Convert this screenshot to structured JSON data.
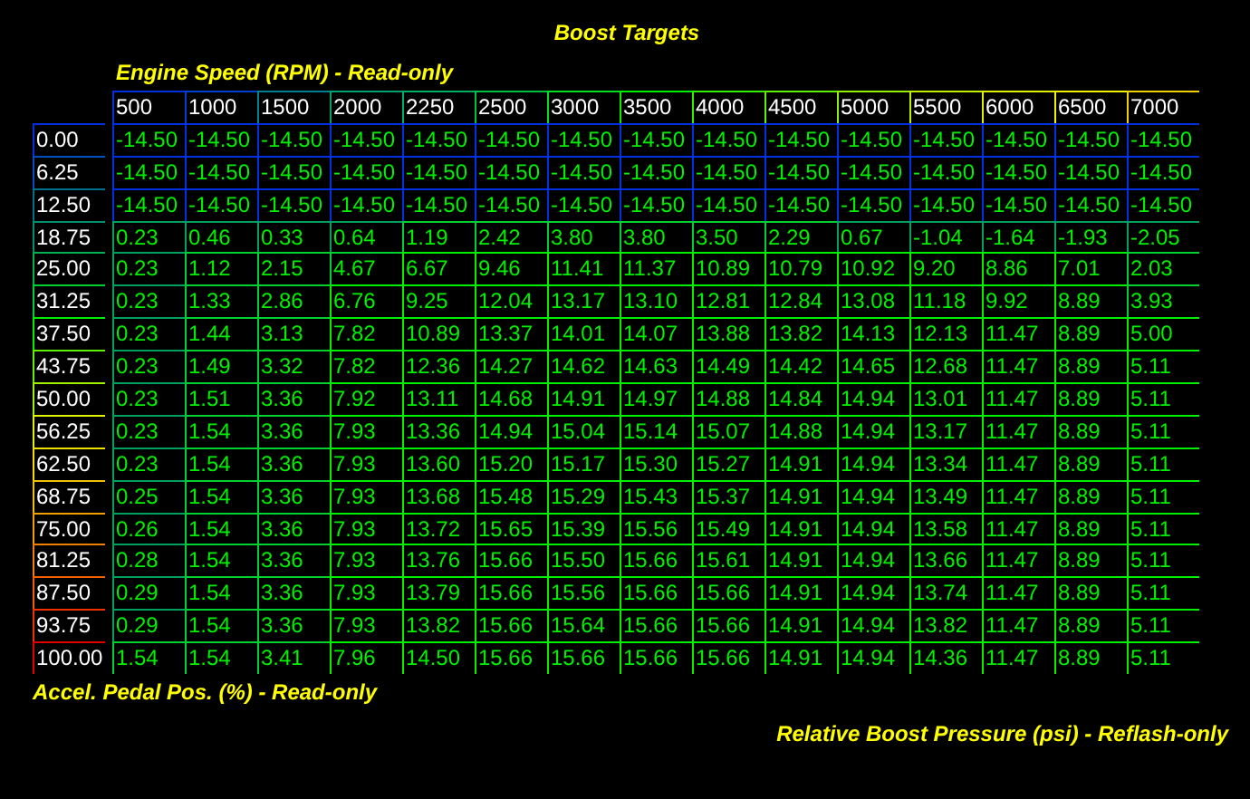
{
  "title": "Boost Targets",
  "x_axis": {
    "label": "Engine Speed (RPM) - Read-only",
    "columns": [
      {
        "text": "500",
        "color": "#0030e0"
      },
      {
        "text": "1000",
        "color": "#0040d0"
      },
      {
        "text": "1500",
        "color": "#008090"
      },
      {
        "text": "2000",
        "color": "#00a070"
      },
      {
        "text": "2250",
        "color": "#00b060"
      },
      {
        "text": "2500",
        "color": "#00c040"
      },
      {
        "text": "3000",
        "color": "#00e020"
      },
      {
        "text": "3500",
        "color": "#00f000"
      },
      {
        "text": "4000",
        "color": "#30f000"
      },
      {
        "text": "4500",
        "color": "#60f000"
      },
      {
        "text": "5000",
        "color": "#90f000"
      },
      {
        "text": "5500",
        "color": "#c0f000"
      },
      {
        "text": "6000",
        "color": "#e0f000"
      },
      {
        "text": "6500",
        "color": "#f0f000"
      },
      {
        "text": "7000",
        "color": "#f0d000"
      }
    ]
  },
  "y_axis": {
    "label": "Accel. Pedal Pos. (%) - Read-only",
    "rows": [
      {
        "text": "0.00",
        "color": "#0030e0"
      },
      {
        "text": "6.25",
        "color": "#0050c0"
      },
      {
        "text": "12.50",
        "color": "#007090"
      },
      {
        "text": "18.75",
        "color": "#009070"
      },
      {
        "text": "25.00",
        "color": "#00b050"
      },
      {
        "text": "31.25",
        "color": "#00d030"
      },
      {
        "text": "37.50",
        "color": "#00f000"
      },
      {
        "text": "43.75",
        "color": "#60f000"
      },
      {
        "text": "50.00",
        "color": "#a0f000"
      },
      {
        "text": "56.25",
        "color": "#e0f000"
      },
      {
        "text": "62.50",
        "color": "#f0e000"
      },
      {
        "text": "68.75",
        "color": "#f0c000"
      },
      {
        "text": "75.00",
        "color": "#f0a000"
      },
      {
        "text": "81.25",
        "color": "#f08000"
      },
      {
        "text": "87.50",
        "color": "#f06000"
      },
      {
        "text": "93.75",
        "color": "#f03000"
      },
      {
        "text": "100.00",
        "color": "#e00000"
      }
    ]
  },
  "values_label": "Relative Boost Pressure (psi) - Reflash-only",
  "cells": [
    [
      "-14.50",
      "-14.50",
      "-14.50",
      "-14.50",
      "-14.50",
      "-14.50",
      "-14.50",
      "-14.50",
      "-14.50",
      "-14.50",
      "-14.50",
      "-14.50",
      "-14.50",
      "-14.50",
      "-14.50"
    ],
    [
      "-14.50",
      "-14.50",
      "-14.50",
      "-14.50",
      "-14.50",
      "-14.50",
      "-14.50",
      "-14.50",
      "-14.50",
      "-14.50",
      "-14.50",
      "-14.50",
      "-14.50",
      "-14.50",
      "-14.50"
    ],
    [
      "-14.50",
      "-14.50",
      "-14.50",
      "-14.50",
      "-14.50",
      "-14.50",
      "-14.50",
      "-14.50",
      "-14.50",
      "-14.50",
      "-14.50",
      "-14.50",
      "-14.50",
      "-14.50",
      "-14.50"
    ],
    [
      "0.23",
      "0.46",
      "0.33",
      "0.64",
      "1.19",
      "2.42",
      "3.80",
      "3.80",
      "3.50",
      "2.29",
      "0.67",
      "-1.04",
      "-1.64",
      "-1.93",
      "-2.05"
    ],
    [
      "0.23",
      "1.12",
      "2.15",
      "4.67",
      "6.67",
      "9.46",
      "11.41",
      "11.37",
      "10.89",
      "10.79",
      "10.92",
      "9.20",
      "8.86",
      "7.01",
      "2.03"
    ],
    [
      "0.23",
      "1.33",
      "2.86",
      "6.76",
      "9.25",
      "12.04",
      "13.17",
      "13.10",
      "12.81",
      "12.84",
      "13.08",
      "11.18",
      "9.92",
      "8.89",
      "3.93"
    ],
    [
      "0.23",
      "1.44",
      "3.13",
      "7.82",
      "10.89",
      "13.37",
      "14.01",
      "14.07",
      "13.88",
      "13.82",
      "14.13",
      "12.13",
      "11.47",
      "8.89",
      "5.00"
    ],
    [
      "0.23",
      "1.49",
      "3.32",
      "7.82",
      "12.36",
      "14.27",
      "14.62",
      "14.63",
      "14.49",
      "14.42",
      "14.65",
      "12.68",
      "11.47",
      "8.89",
      "5.11"
    ],
    [
      "0.23",
      "1.51",
      "3.36",
      "7.92",
      "13.11",
      "14.68",
      "14.91",
      "14.97",
      "14.88",
      "14.84",
      "14.94",
      "13.01",
      "11.47",
      "8.89",
      "5.11"
    ],
    [
      "0.23",
      "1.54",
      "3.36",
      "7.93",
      "13.36",
      "14.94",
      "15.04",
      "15.14",
      "15.07",
      "14.88",
      "14.94",
      "13.17",
      "11.47",
      "8.89",
      "5.11"
    ],
    [
      "0.23",
      "1.54",
      "3.36",
      "7.93",
      "13.60",
      "15.20",
      "15.17",
      "15.30",
      "15.27",
      "14.91",
      "14.94",
      "13.34",
      "11.47",
      "8.89",
      "5.11"
    ],
    [
      "0.25",
      "1.54",
      "3.36",
      "7.93",
      "13.68",
      "15.48",
      "15.29",
      "15.43",
      "15.37",
      "14.91",
      "14.94",
      "13.49",
      "11.47",
      "8.89",
      "5.11"
    ],
    [
      "0.26",
      "1.54",
      "3.36",
      "7.93",
      "13.72",
      "15.65",
      "15.39",
      "15.56",
      "15.49",
      "14.91",
      "14.94",
      "13.58",
      "11.47",
      "8.89",
      "5.11"
    ],
    [
      "0.28",
      "1.54",
      "3.36",
      "7.93",
      "13.76",
      "15.66",
      "15.50",
      "15.66",
      "15.61",
      "14.91",
      "14.94",
      "13.66",
      "11.47",
      "8.89",
      "5.11"
    ],
    [
      "0.29",
      "1.54",
      "3.36",
      "7.93",
      "13.79",
      "15.66",
      "15.56",
      "15.66",
      "15.66",
      "14.91",
      "14.94",
      "13.74",
      "11.47",
      "8.89",
      "5.11"
    ],
    [
      "0.29",
      "1.54",
      "3.36",
      "7.93",
      "13.82",
      "15.66",
      "15.64",
      "15.66",
      "15.66",
      "14.91",
      "14.94",
      "13.82",
      "11.47",
      "8.89",
      "5.11"
    ],
    [
      "1.54",
      "1.54",
      "3.41",
      "7.96",
      "14.50",
      "15.66",
      "15.66",
      "15.66",
      "15.66",
      "14.91",
      "14.94",
      "14.36",
      "11.47",
      "8.89",
      "5.11"
    ]
  ]
}
